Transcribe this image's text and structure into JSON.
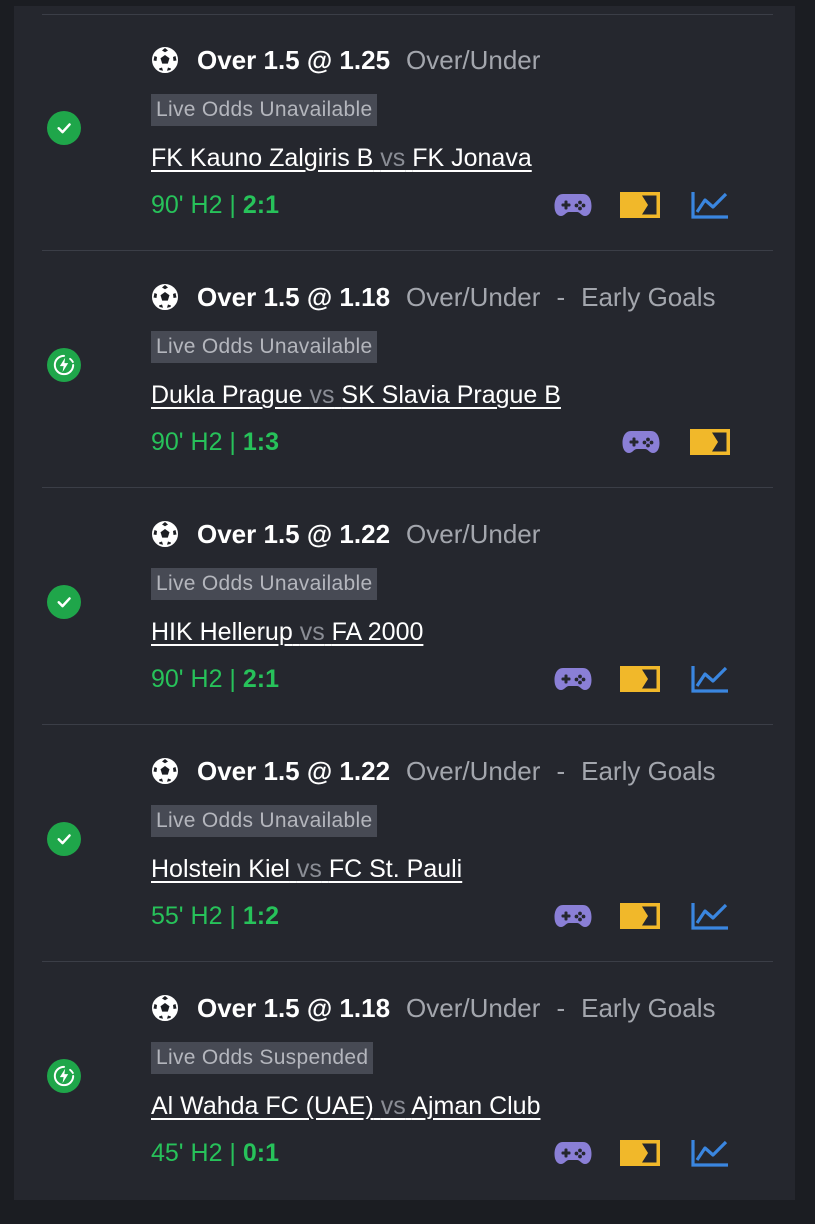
{
  "colors": {
    "background": "#1b1d22",
    "panel": "#25272e",
    "win_green": "#1fa64a",
    "score_green": "#27c25a",
    "gamepad_purple": "#8a7fd6",
    "ticket_yellow": "#f1b82a",
    "chart_blue": "#3a86e0"
  },
  "bets": [
    {
      "status_icon": "check-icon",
      "selection": "Over 1.5 @ 1.25",
      "market": "Over/Under",
      "dash": "",
      "submarket": "",
      "odds_status": "Live Odds Unavailable",
      "home": "FK Kauno Zalgiris B",
      "vs": "vs",
      "away": "FK Jonava",
      "time": "90' H2 | ",
      "score": "2:1",
      "has_chart": true
    },
    {
      "status_icon": "lightning-refresh-icon",
      "selection": "Over 1.5 @ 1.18",
      "market": "Over/Under",
      "dash": "-",
      "submarket": "Early Goals",
      "odds_status": "Live Odds Unavailable",
      "home": "Dukla Prague",
      "vs": "vs",
      "away": "SK Slavia Prague B",
      "time": "90' H2 | ",
      "score": "1:3",
      "has_chart": false
    },
    {
      "status_icon": "check-icon",
      "selection": "Over 1.5 @ 1.22",
      "market": "Over/Under",
      "dash": "",
      "submarket": "",
      "odds_status": "Live Odds Unavailable",
      "home": "HIK Hellerup",
      "vs": "vs",
      "away": "FA 2000",
      "time": "90' H2 | ",
      "score": "2:1",
      "has_chart": true
    },
    {
      "status_icon": "check-icon",
      "selection": "Over 1.5 @ 1.22",
      "market": "Over/Under",
      "dash": "-",
      "submarket": "Early Goals",
      "odds_status": "Live Odds Unavailable",
      "home": "Holstein Kiel",
      "vs": "vs",
      "away": "FC St. Pauli",
      "time": "55' H2 | ",
      "score": "1:2",
      "has_chart": true
    },
    {
      "status_icon": "lightning-refresh-icon",
      "selection": "Over 1.5 @ 1.18",
      "market": "Over/Under",
      "dash": "-",
      "submarket": "Early Goals",
      "odds_status": "Live Odds Suspended",
      "home": "Al Wahda FC (UAE)",
      "vs": "vs",
      "away": "Ajman Club",
      "time": "45' H2 | ",
      "score": "0:1",
      "has_chart": true
    }
  ]
}
